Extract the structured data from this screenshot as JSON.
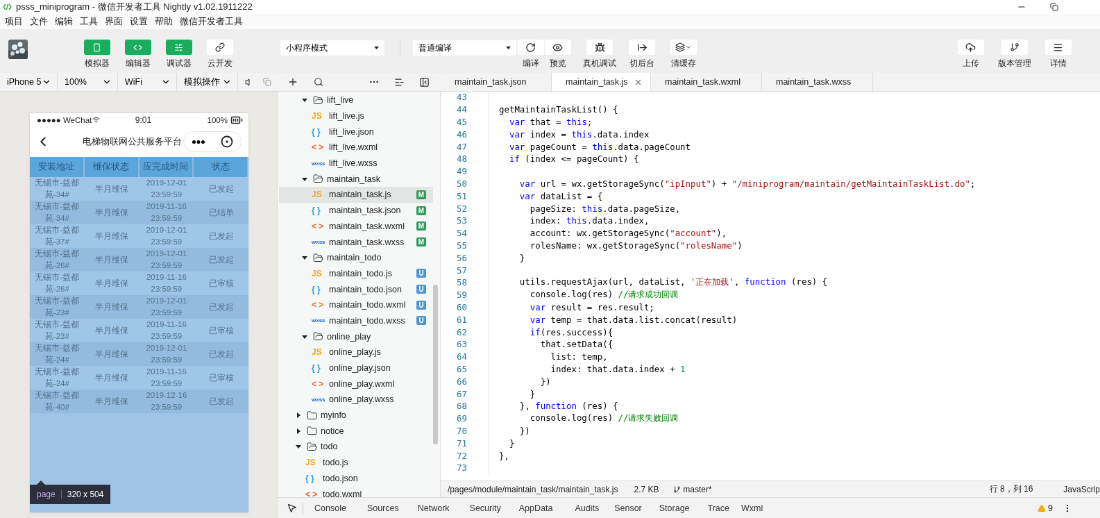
{
  "window": {
    "title": "psss_miniprogram - 微信开发者工具 Nightly v1.02.1911222"
  },
  "menu": [
    "项目",
    "文件",
    "编辑",
    "工具",
    "界面",
    "设置",
    "帮助",
    "微信开发者工具"
  ],
  "toolbar": {
    "panels": [
      {
        "kind": "phone",
        "label": "模拟器",
        "selected": true
      },
      {
        "kind": "code",
        "label": "编辑器",
        "selected": true
      },
      {
        "kind": "sliders",
        "label": "调试器",
        "selected": true
      },
      {
        "kind": "cloud",
        "label": "云开发",
        "selected": false
      }
    ],
    "mode_select": "小程序模式",
    "compile_select": "普通编译",
    "actions": [
      {
        "kind": "refresh",
        "label": "编译"
      },
      {
        "kind": "eye",
        "label": "预览"
      },
      {
        "kind": "bug",
        "label": "真机调试"
      },
      {
        "kind": "background",
        "label": "切后台"
      },
      {
        "kind": "layers",
        "label": "清缓存"
      }
    ],
    "right_actions": [
      {
        "kind": "upload",
        "label": "上传"
      },
      {
        "kind": "branch",
        "label": "版本管理"
      },
      {
        "kind": "menu",
        "label": "详情"
      }
    ]
  },
  "simulator": {
    "selects": [
      "iPhone 5",
      "100%",
      "WiFi",
      "模拟操作"
    ],
    "phone": {
      "carrier": "●●●●● WeChat",
      "time": "9:01",
      "battery": "100%",
      "title": "电梯物联网公共服务平台",
      "columns": [
        "安装地址",
        "维保状态",
        "应完成时间",
        "状态"
      ],
      "rows": [
        [
          "无锡市-益都苑-34#",
          "半月维保",
          "2019-12-01 23:59:59",
          "已发起"
        ],
        [
          "无锡市-益都苑-34#",
          "半月维保",
          "2019-11-16 23:59:59",
          "已结单"
        ],
        [
          "无锡市-益都苑-37#",
          "半月维保",
          "2019-12-01 23:59:59",
          "已发起"
        ],
        [
          "无锡市-益都苑-26#",
          "半月维保",
          "2019-12-01 23:59:59",
          "已发起"
        ],
        [
          "无锡市-益都苑-26#",
          "半月维保",
          "2019-11-16 23:59:59",
          "已审核"
        ],
        [
          "无锡市-益都苑-23#",
          "半月维保",
          "2019-12-01 23:59:59",
          "已发起"
        ],
        [
          "无锡市-益都苑-23#",
          "半月维保",
          "2019-11-16 23:59:59",
          "已审核"
        ],
        [
          "无锡市-益都苑-24#",
          "半月维保",
          "2019-12-01 23:59:59",
          "已发起"
        ],
        [
          "无锡市-益都苑-24#",
          "半月维保",
          "2019-11-16 23:59:59",
          "已审核"
        ],
        [
          "无锡市-益都苑-40#",
          "半月维保",
          "2019-12-16 23:59:59",
          "已发起"
        ]
      ]
    },
    "inspector": {
      "tag": "page",
      "size": "320 x 504"
    }
  },
  "tree": {
    "items": [
      {
        "kind": "continued",
        "children": [
          {
            "kind": "folder",
            "name": "lift_live",
            "expanded": true,
            "selected": false,
            "children": [
              {
                "kind": "file",
                "color": "#f4a81d",
                "mark": "JS",
                "name": "lift_live.js",
                "selected": false
              },
              {
                "kind": "file",
                "color": "#1fa1e0",
                "mark": "{ }",
                "name": "lift_live.json",
                "selected": false
              },
              {
                "kind": "file",
                "color": "#f2602f",
                "mark": "< >",
                "name": "lift_live.wxml",
                "selected": false
              },
              {
                "kind": "file",
                "color": "#1f66c2",
                "mark": "wxss",
                "name": "lift_live.wxss",
                "selected": false
              }
            ]
          },
          {
            "kind": "folder",
            "name": "maintain_task",
            "expanded": true,
            "selected": false,
            "children": [
              {
                "kind": "file",
                "color": "#f4a81d",
                "mark": "JS",
                "name": "maintain_task.js",
                "selected": true,
                "badge": {
                  "text": "M",
                  "color": "#2e9d57"
                }
              },
              {
                "kind": "file",
                "color": "#1fa1e0",
                "mark": "{ }",
                "name": "maintain_task.json",
                "selected": false,
                "badge": {
                  "text": "M",
                  "color": "#2e9d57"
                }
              },
              {
                "kind": "file",
                "color": "#f2602f",
                "mark": "< >",
                "name": "maintain_task.wxml",
                "selected": false,
                "badge": {
                  "text": "M",
                  "color": "#2e9d57"
                }
              },
              {
                "kind": "file",
                "color": "#1f66c2",
                "mark": "wxss",
                "name": "maintain_task.wxss",
                "selected": false,
                "badge": {
                  "text": "M",
                  "color": "#2e9d57"
                }
              }
            ]
          },
          {
            "kind": "folder",
            "name": "maintain_todo",
            "expanded": true,
            "selected": false,
            "children": [
              {
                "kind": "file",
                "color": "#f4a81d",
                "mark": "JS",
                "name": "maintain_todo.js",
                "selected": false,
                "badge": {
                  "text": "U",
                  "color": "#4a98cf"
                }
              },
              {
                "kind": "file",
                "color": "#1fa1e0",
                "mark": "{ }",
                "name": "maintain_todo.json",
                "selected": false,
                "badge": {
                  "text": "U",
                  "color": "#4a98cf"
                }
              },
              {
                "kind": "file",
                "color": "#f2602f",
                "mark": "< >",
                "name": "maintain_todo.wxml",
                "selected": false,
                "badge": {
                  "text": "U",
                  "color": "#4a98cf"
                }
              },
              {
                "kind": "file",
                "color": "#1f66c2",
                "mark": "wxss",
                "name": "maintain_todo.wxss",
                "selected": false,
                "badge": {
                  "text": "U",
                  "color": "#4a98cf"
                }
              }
            ]
          },
          {
            "kind": "folder",
            "name": "online_play",
            "expanded": true,
            "selected": false,
            "children": [
              {
                "kind": "file",
                "color": "#f4a81d",
                "mark": "JS",
                "name": "online_play.js",
                "selected": false
              },
              {
                "kind": "file",
                "color": "#1fa1e0",
                "mark": "{ }",
                "name": "online_play.json",
                "selected": false
              },
              {
                "kind": "file",
                "color": "#f2602f",
                "mark": "< >",
                "name": "online_play.wxml",
                "selected": false
              },
              {
                "kind": "file",
                "color": "#1f66c2",
                "mark": "wxss",
                "name": "online_play.wxss",
                "selected": false
              }
            ]
          }
        ]
      },
      {
        "kind": "folder",
        "name": "myinfo",
        "expanded": false,
        "selected": false
      },
      {
        "kind": "folder",
        "name": "notice",
        "expanded": false,
        "selected": false
      },
      {
        "kind": "folder",
        "name": "todo",
        "expanded": true,
        "selected": false,
        "children": [
          {
            "kind": "file",
            "color": "#f4a81d",
            "mark": "JS",
            "name": "todo.js",
            "selected": false
          },
          {
            "kind": "file",
            "color": "#1fa1e0",
            "mark": "{ }",
            "name": "todo.json",
            "selected": false
          },
          {
            "kind": "file",
            "color": "#f2602f",
            "mark": "< >",
            "name": "todo.wxml",
            "selected": false
          }
        ]
      }
    ]
  },
  "editor": {
    "tabs": [
      {
        "label": "maintain_task.json",
        "selected": false
      },
      {
        "label": "maintain_task.js",
        "selected": true
      },
      {
        "label": "maintain_task.wxml",
        "selected": false
      },
      {
        "label": "maintain_task.wxss",
        "selected": false
      }
    ],
    "lines": [
      {
        "n": "43"
      },
      {
        "n": "44",
        "segs": [
          {
            "kind": "p",
            "text": "getMaintainTaskList() {"
          }
        ]
      },
      {
        "n": "45",
        "segs": [
          {
            "kind": "kw",
            "text": "  var"
          },
          {
            "kind": "p",
            "text": " that = "
          },
          {
            "kind": "kw",
            "text": "this"
          },
          {
            "kind": "p",
            "text": ";"
          }
        ]
      },
      {
        "n": "46",
        "segs": [
          {
            "kind": "kw",
            "text": "  var"
          },
          {
            "kind": "p",
            "text": " index = "
          },
          {
            "kind": "kw",
            "text": "this"
          },
          {
            "kind": "p",
            "text": ".data.index"
          }
        ]
      },
      {
        "n": "47",
        "segs": [
          {
            "kind": "kw",
            "text": "  var"
          },
          {
            "kind": "p",
            "text": " pageCount = "
          },
          {
            "kind": "kw",
            "text": "this"
          },
          {
            "kind": "p",
            "text": ".data.pageCount"
          }
        ]
      },
      {
        "n": "48",
        "segs": [
          {
            "kind": "kw",
            "text": "  if"
          },
          {
            "kind": "p",
            "text": " (index <= pageCount) {"
          }
        ]
      },
      {
        "n": "49"
      },
      {
        "n": "50",
        "segs": [
          {
            "kind": "kw",
            "text": "    var"
          },
          {
            "kind": "p",
            "text": " url = wx.getStorageSync("
          },
          {
            "kind": "str",
            "text": "\"ipInput\""
          },
          {
            "kind": "p",
            "text": ") + "
          },
          {
            "kind": "str",
            "text": "\"/miniprogram/maintain/getMaintainTaskList.do\""
          },
          {
            "kind": "p",
            "text": ";"
          }
        ]
      },
      {
        "n": "51",
        "segs": [
          {
            "kind": "kw",
            "text": "    var"
          },
          {
            "kind": "p",
            "text": " dataList = {"
          }
        ]
      },
      {
        "n": "52",
        "segs": [
          {
            "kind": "p",
            "text": "      pageSize: "
          },
          {
            "kind": "kw",
            "text": "this"
          },
          {
            "kind": "p",
            "text": ".data.pageSize,"
          }
        ]
      },
      {
        "n": "53",
        "segs": [
          {
            "kind": "p",
            "text": "      index: "
          },
          {
            "kind": "kw",
            "text": "this"
          },
          {
            "kind": "p",
            "text": ".data.index,"
          }
        ]
      },
      {
        "n": "54",
        "segs": [
          {
            "kind": "p",
            "text": "      account: wx.getStorageSync("
          },
          {
            "kind": "str",
            "text": "\"account\""
          },
          {
            "kind": "p",
            "text": "),"
          }
        ]
      },
      {
        "n": "55",
        "segs": [
          {
            "kind": "p",
            "text": "      rolesName: wx.getStorageSync("
          },
          {
            "kind": "str",
            "text": "\"rolesName\""
          },
          {
            "kind": "p",
            "text": ")"
          }
        ]
      },
      {
        "n": "56",
        "segs": [
          {
            "kind": "p",
            "text": "    }"
          }
        ]
      },
      {
        "n": "57"
      },
      {
        "n": "58",
        "segs": [
          {
            "kind": "p",
            "text": "    utils.requestAjax(url, dataList, "
          },
          {
            "kind": "str",
            "text": "'正在加载'"
          },
          {
            "kind": "p",
            "text": ", "
          },
          {
            "kind": "kw",
            "text": "function"
          },
          {
            "kind": "p",
            "text": " (res) {"
          }
        ]
      },
      {
        "n": "59",
        "segs": [
          {
            "kind": "p",
            "text": "      console.log(res) "
          },
          {
            "kind": "cmt",
            "text": "//请求成功回调"
          }
        ]
      },
      {
        "n": "60",
        "segs": [
          {
            "kind": "kw",
            "text": "      var"
          },
          {
            "kind": "p",
            "text": " result = res.result;"
          }
        ]
      },
      {
        "n": "61",
        "segs": [
          {
            "kind": "kw",
            "text": "      var"
          },
          {
            "kind": "p",
            "text": " temp = that.data.list.concat(result)"
          }
        ]
      },
      {
        "n": "62",
        "segs": [
          {
            "kind": "kw",
            "text": "      if"
          },
          {
            "kind": "p",
            "text": "(res.success){"
          }
        ]
      },
      {
        "n": "63",
        "segs": [
          {
            "kind": "p",
            "text": "        that.setData({"
          }
        ]
      },
      {
        "n": "64",
        "segs": [
          {
            "kind": "p",
            "text": "          list: temp,"
          }
        ]
      },
      {
        "n": "65",
        "segs": [
          {
            "kind": "p",
            "text": "          index: that.data.index + "
          },
          {
            "kind": "num",
            "text": "1"
          }
        ]
      },
      {
        "n": "66",
        "segs": [
          {
            "kind": "p",
            "text": "        })"
          }
        ]
      },
      {
        "n": "67",
        "segs": [
          {
            "kind": "p",
            "text": "      }"
          }
        ]
      },
      {
        "n": "68",
        "segs": [
          {
            "kind": "p",
            "text": "    }, "
          },
          {
            "kind": "kw",
            "text": "function"
          },
          {
            "kind": "p",
            "text": " (res) {"
          }
        ]
      },
      {
        "n": "69",
        "segs": [
          {
            "kind": "p",
            "text": "      console.log(res) "
          },
          {
            "kind": "cmt",
            "text": "//请求失败回调"
          }
        ]
      },
      {
        "n": "70",
        "segs": [
          {
            "kind": "p",
            "text": "    })"
          }
        ]
      },
      {
        "n": "71",
        "segs": [
          {
            "kind": "p",
            "text": "  }"
          }
        ]
      },
      {
        "n": "72",
        "segs": [
          {
            "kind": "p",
            "text": "},"
          }
        ]
      },
      {
        "n": "73"
      }
    ]
  },
  "status_bar": {
    "path": "/pages/module/maintain_task/maintain_task.js",
    "size": "2.7 KB",
    "branch": "master*",
    "position": "行 8，列 16",
    "language": "JavaScrip"
  },
  "devtools": {
    "tabs": [
      "Console",
      "Sources",
      "Network",
      "Security",
      "AppData",
      "Audits",
      "Sensor",
      "Storage",
      "Trace",
      "Wxml"
    ],
    "warnings": "9"
  }
}
